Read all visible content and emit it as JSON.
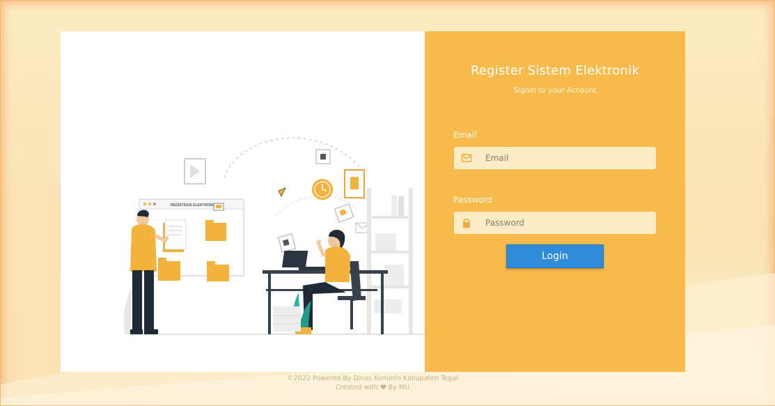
{
  "form": {
    "title": "Register Sistem Elektronik",
    "subtitle": "Signin to your Account",
    "email_label": "Email",
    "email_placeholder": "Email",
    "password_label": "Password",
    "password_placeholder": "Password",
    "login_label": "Login"
  },
  "illustration": {
    "screen_text": "REGISTRASI ELEKTRONIK"
  },
  "footer": {
    "line1": "©2022 Powered By Dinas Kominfo Kabupaten Tegal",
    "line2_prefix": "Created with",
    "line2_suffix": "By MU"
  },
  "colors": {
    "panel": "#f7bb4d",
    "button": "#2f8ad8",
    "background": "#fbe6bb"
  },
  "icons": {
    "email": "envelope-icon",
    "password": "lock-icon",
    "footer": "heart-icon"
  }
}
